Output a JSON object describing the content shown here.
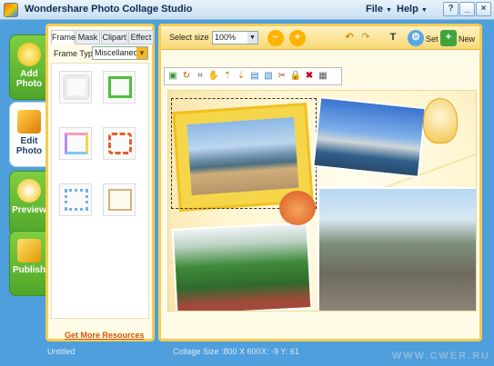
{
  "window": {
    "title": "Wondershare Photo Collage Studio",
    "menus": [
      {
        "label": "File"
      },
      {
        "label": "Help"
      }
    ],
    "buttons": {
      "help": "?",
      "minimize": "_",
      "close": "×"
    }
  },
  "left_tabs": [
    {
      "line1": "Add",
      "line2": "Photo",
      "active": false
    },
    {
      "line1": "Edit",
      "line2": "Photo",
      "active": true
    },
    {
      "line1": "Preview",
      "line2": "",
      "active": false
    },
    {
      "line1": "Publish",
      "line2": "",
      "active": false
    }
  ],
  "left_panel": {
    "subtabs": [
      "Frame",
      "Mask",
      "Clipart",
      "Effect"
    ],
    "active_subtab": "Frame",
    "frame_type_label": "Frame Type:",
    "frame_type_value": "Miscellaneous",
    "more_link": "Get More Resources"
  },
  "toolbar": {
    "size_label": "Select size",
    "size_value": "100%",
    "set_label": "Set",
    "new_label": "New"
  },
  "status": {
    "file": "Untitled",
    "collage_size": "Collage Size :800 X 600",
    "coords": "X: -9   Y: 61"
  },
  "watermark": "WWW.CWER.RU"
}
